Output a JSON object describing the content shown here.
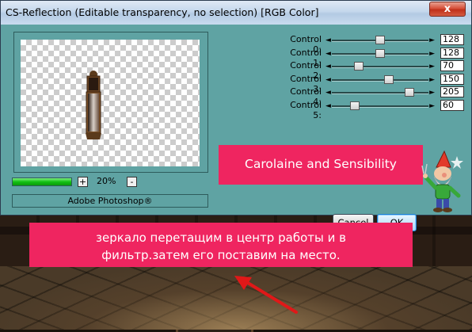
{
  "window": {
    "title": "CS-Reflection (Editable transparency, no selection) [RGB Color]",
    "close_glyph": "x"
  },
  "preview": {
    "zoom_value": "20%",
    "zoom_in_label": "+",
    "zoom_out_label": "-",
    "progress_fraction": 1.0,
    "footer_label": "Adobe Photoshop®"
  },
  "controls": [
    {
      "label": "Control 0:",
      "value": "128",
      "fraction": 0.502
    },
    {
      "label": "Control 1:",
      "value": "128",
      "fraction": 0.502
    },
    {
      "label": "Control 2:",
      "value": "70",
      "fraction": 0.275
    },
    {
      "label": "Control 3:",
      "value": "150",
      "fraction": 0.588
    },
    {
      "label": "Control 4:",
      "value": "205",
      "fraction": 0.804
    },
    {
      "label": "Control 5:",
      "value": "60",
      "fraction": 0.235
    }
  ],
  "banner": {
    "text": "Carolaine and Sensibility"
  },
  "buttons": {
    "cancel": "Cancel",
    "ok": "OK"
  },
  "note": {
    "line1": "зеркало перетащим в центр работы и в",
    "line2": "фильтр.затем его поставим на место."
  },
  "colors": {
    "dialog_bg": "#5fa3a3",
    "banner_bg": "#ef2560",
    "progress": "#12c012"
  }
}
